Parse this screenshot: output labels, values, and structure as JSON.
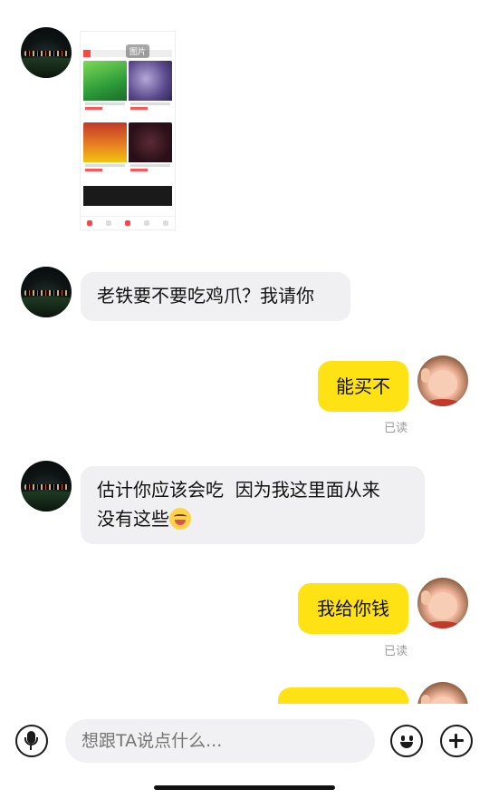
{
  "messages": [
    {
      "id": "m1",
      "side": "in",
      "type": "image",
      "image": {
        "overlay_label": "图片"
      }
    },
    {
      "id": "m2",
      "side": "in",
      "type": "text",
      "text": "老铁要不要吃鸡爪？我请你"
    },
    {
      "id": "m3",
      "side": "out",
      "type": "text",
      "text": "能买不",
      "status": "已读"
    },
    {
      "id": "m4",
      "side": "in",
      "type": "text",
      "line1": "估计你应该会吃  因为我这里面从来",
      "line2": "没有这些",
      "emoji": "grinning-tongue-emoji"
    },
    {
      "id": "m5",
      "side": "out",
      "type": "text",
      "text": "我给你钱",
      "status": "已读"
    },
    {
      "id": "m6",
      "side": "out",
      "type": "text",
      "text": ""
    }
  ],
  "input_bar": {
    "placeholder": "想跟TA说点什么...",
    "voice_icon": "microphone-icon",
    "emoji_icon": "smiley-icon",
    "more_icon": "plus-icon"
  },
  "colors": {
    "incoming_bubble": "#f0f0f2",
    "outgoing_bubble": "#ffe214",
    "read_text": "#9a9a9a"
  }
}
